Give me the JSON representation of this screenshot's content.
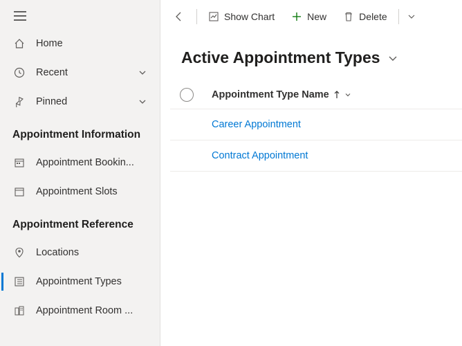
{
  "sidebar": {
    "top": [
      {
        "label": "Home"
      },
      {
        "label": "Recent"
      },
      {
        "label": "Pinned"
      }
    ],
    "groups": [
      {
        "title": "Appointment Information",
        "items": [
          {
            "label": "Appointment Bookin..."
          },
          {
            "label": "Appointment Slots"
          }
        ]
      },
      {
        "title": "Appointment Reference",
        "items": [
          {
            "label": "Locations"
          },
          {
            "label": "Appointment Types"
          },
          {
            "label": "Appointment Room ..."
          }
        ]
      }
    ]
  },
  "cmdbar": {
    "show_chart": "Show Chart",
    "new": "New",
    "delete": "Delete"
  },
  "page": {
    "title": "Active Appointment Types"
  },
  "grid": {
    "column": "Appointment Type Name",
    "rows": [
      {
        "name": "Career Appointment"
      },
      {
        "name": "Contract Appointment"
      }
    ]
  }
}
